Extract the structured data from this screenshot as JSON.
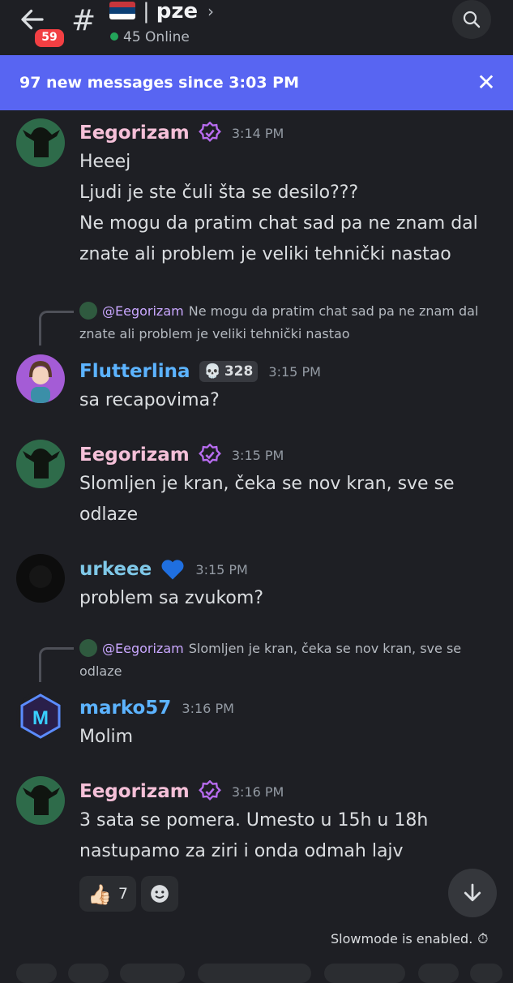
{
  "header": {
    "unread_count": "59",
    "channel_name": "pze",
    "channel_separator": "|",
    "online_text": "45 Online",
    "flag_colors": [
      "#c6363c",
      "#0c4076",
      "#ffffff"
    ],
    "flag_icon": "serbia-flag",
    "back_icon": "arrow-left-icon",
    "search_icon": "search-icon"
  },
  "new_messages_bar": {
    "text": "97 new messages since 3:03 PM",
    "close_icon": "close-icon"
  },
  "messages": [
    {
      "author": "Eegorizam",
      "author_color": "#f5c0d8",
      "time": "3:14 PM",
      "lines": [
        "Heeej",
        "Ljudi je ste čuli šta se desilo???",
        "Ne mogu da pratim chat sad pa ne znam dal znate ali problem je veliki tehnički nastao"
      ]
    },
    {
      "reply": {
        "mention": "@Eegorizam",
        "text": "Ne mogu da pratim chat sad pa ne znam dal znate ali problem je veliki tehnički nastao"
      },
      "author": "Flutterlina",
      "author_color": "#5cb3ff",
      "badge": "328",
      "time": "3:15 PM",
      "lines": [
        "sa recapovima?"
      ]
    },
    {
      "author": "Eegorizam",
      "time": "3:15 PM",
      "lines": [
        "Slomljen je kran, čeka se nov kran, sve se odlaze"
      ]
    },
    {
      "author": "urkeee",
      "author_color": "#7fc8e8",
      "time": "3:15 PM",
      "lines": [
        "problem sa zvukom?"
      ]
    },
    {
      "reply": {
        "mention": "@Eegorizam",
        "text": "Slomljen je kran, čeka se nov kran, sve se odlaze"
      },
      "author": "marko57",
      "author_color": "#5cb3ff",
      "time": "3:16 PM",
      "lines": [
        "Molim"
      ]
    },
    {
      "author": "Eegorizam",
      "time": "3:16 PM",
      "lines": [
        "3 sata se pomera. Umesto u 15h u 18h nastupamo za ziri i onda odmah lajv"
      ],
      "reactions": [
        {
          "emoji": "👍🏻",
          "count": "7"
        }
      ]
    }
  ],
  "footer": {
    "slowmode_text": "Slowmode is enabled.",
    "scroll_icon": "arrow-down-icon"
  },
  "colors": {
    "background": "#1e1f24",
    "banner": "#5865f2",
    "unread_badge": "#f23f43",
    "online": "#23a55a"
  }
}
